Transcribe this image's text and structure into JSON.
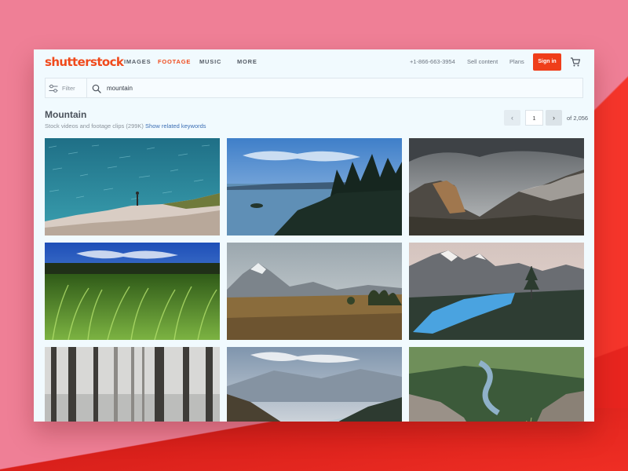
{
  "header": {
    "logo": "shutterstock",
    "nav": [
      "IMAGES",
      "FOOTAGE",
      "MUSIC",
      "MORE"
    ],
    "active_nav": "FOOTAGE",
    "phone": "+1-866-663-3954",
    "sell_content": "Sell content",
    "plans": "Plans",
    "sign_in": "Sign in"
  },
  "search": {
    "filter_label": "Filter",
    "query": "mountain"
  },
  "results": {
    "title": "Mountain",
    "summary": "Stock videos and footage clips (299K)",
    "related_link": "Show related keywords"
  },
  "pagination": {
    "current_page": "1",
    "total": "of 2,056"
  },
  "colors": {
    "brand": "#f04a1c",
    "sign_in_bg": "#ef3e1a",
    "link": "#3b6eb4",
    "backdrop_pink": "#ef7f96",
    "backdrop_red": "#f5352b"
  },
  "grid": {
    "tiles": [
      {
        "subject": "sea-cliff-hiker"
      },
      {
        "subject": "forest-lake"
      },
      {
        "subject": "cloudy-cliffs"
      },
      {
        "subject": "fern-meadow"
      },
      {
        "subject": "valley-plain"
      },
      {
        "subject": "alpine-lake"
      },
      {
        "subject": "misty-forest"
      },
      {
        "subject": "river-valley"
      },
      {
        "subject": "canyon-river"
      }
    ]
  }
}
